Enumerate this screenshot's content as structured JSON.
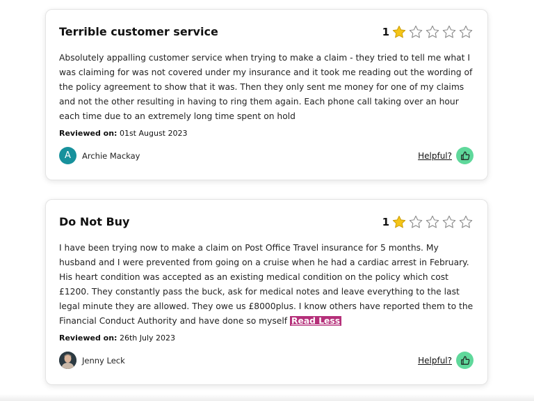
{
  "reviews": [
    {
      "title": "Terrible customer service",
      "rating": "1",
      "rating_value": 1,
      "rating_max": 5,
      "body": "Absolutely appalling customer service when trying to make a claim - they tried to tell me what I was claiming for was not covered under my insurance and it took me reading out the wording of the policy agreement to show that it was. Then they only sent me money for one of my claims and not the other resulting in having to ring them again. Each phone call taking over an hour each time due to an extremely long time spent on hold",
      "reviewed_label": "Reviewed on:",
      "reviewed_date": "01st August 2023",
      "reviewer_initial": "A",
      "reviewer_name": "Archie Mackay",
      "helpful_label": "Helpful?"
    },
    {
      "title": "Do Not Buy",
      "rating": "1",
      "rating_value": 1,
      "rating_max": 5,
      "body": "I have been trying now to make a claim on Post Office Travel insurance for 5 months. My husband and I were prevented from going on a cruise when he had a cardiac arrest in February. His heart condition was accepted as an existing medical condition on the policy which cost £1200. They constantly pass the buck, ask for medical notes and leave everything to the last legal minute they are allowed. They owe us £8000plus. I know others have reported them to the Financial Conduct Authority and have done so myself",
      "read_less_label": "Read Less",
      "reviewed_label": "Reviewed on:",
      "reviewed_date": "26th July 2023",
      "reviewer_name": "Jenny Leck",
      "helpful_label": "Helpful?"
    }
  ],
  "colors": {
    "star_filled": "#f5c518",
    "star_empty_stroke": "#8a8a8a",
    "helpful_button": "#5fd89b",
    "avatar_letter_bg": "#17919c",
    "read_less_bg": "#b5307a"
  },
  "icons": {
    "star": "star-icon",
    "thumbs_up": "thumbs-up-icon"
  }
}
